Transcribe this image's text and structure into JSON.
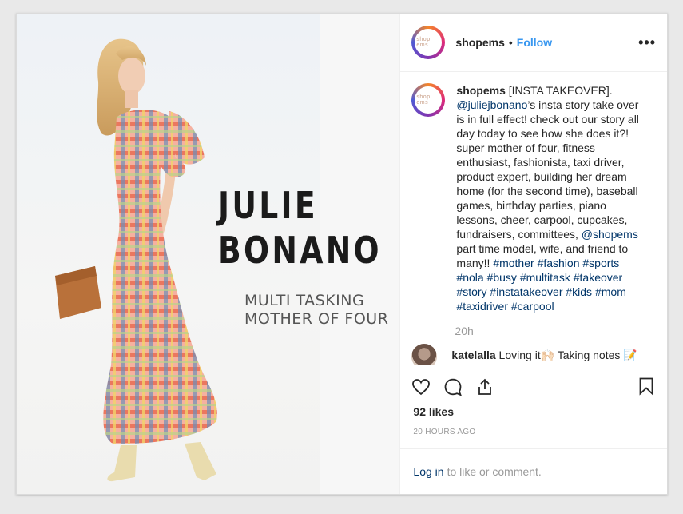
{
  "post": {
    "image": {
      "headline_line1": "JULIE",
      "headline_line2": "BONANO",
      "tagline_line1": "MULTI TASKING",
      "tagline_line2": "MOTHER OF FOUR"
    },
    "header": {
      "username": "shopems",
      "separator": "•",
      "follow_label": "Follow",
      "more_label": "•••",
      "avatar_text": "shop ems"
    },
    "caption": {
      "username": "shopems",
      "text_1": " [INSTA TAKEOVER]. ",
      "mention_1": "@juliejbonano",
      "text_2": "’s insta story take over is in full effect! check out our story all day today to see how she does it?! super mother of four, fitness enthusiast, fashionista, taxi driver, product expert, building her dream home (for the second time), baseball games, birthday parties, piano lessons, cheer, carpool, cupcakes, fundraisers, committees, ",
      "mention_2": "@shopems",
      "text_3": " part time model, wife, and friend to many!! ",
      "hashtags": [
        "#mother",
        "#fashion",
        "#sports",
        "#nola",
        "#busy",
        "#multitask",
        "#takeover",
        "#story",
        "#instatakeover",
        "#kids",
        "#mom",
        "#taxidriver",
        "#carpool"
      ],
      "time": "20h"
    },
    "comments": [
      {
        "username": "katelalla",
        "text": " Loving it🙌🏻 Taking notes 📝"
      }
    ],
    "likes": "92 likes",
    "posted_ago": "20 HOURS AGO",
    "login": {
      "link": "Log in",
      "text": "to like or comment."
    }
  },
  "colors": {
    "accent": "#3897f0",
    "link": "#003569",
    "text": "#262626",
    "muted": "#999999"
  },
  "icons": [
    "heart-icon",
    "comment-icon",
    "share-icon",
    "bookmark-icon",
    "more-options-icon"
  ]
}
